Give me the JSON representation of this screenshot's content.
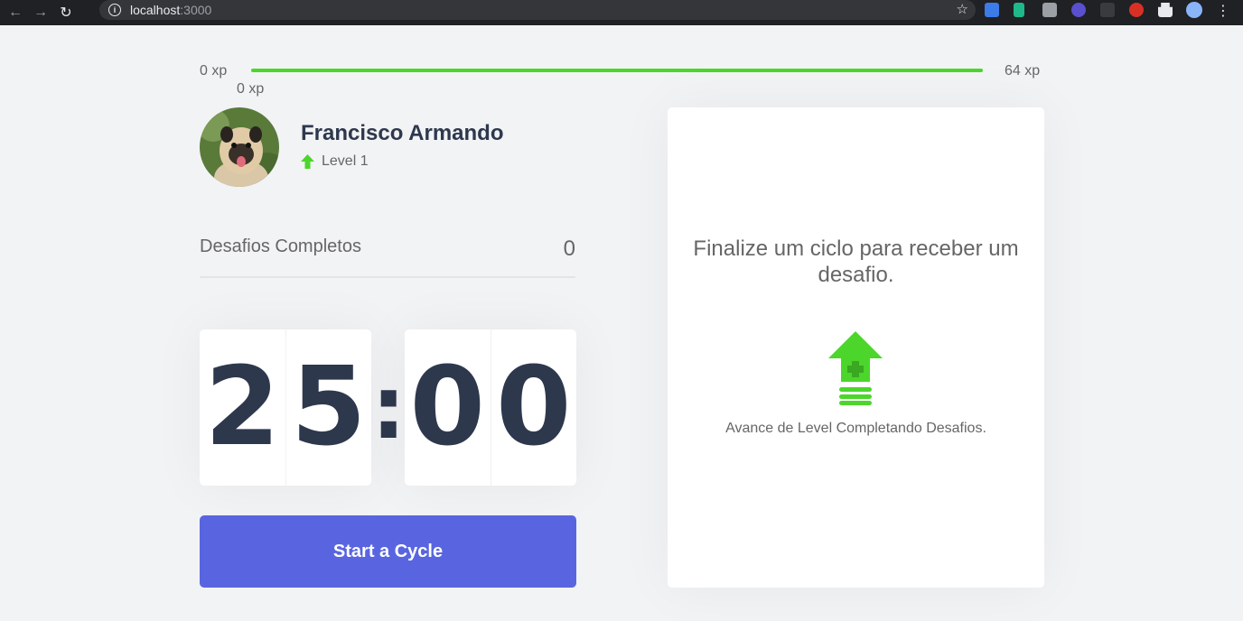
{
  "browser": {
    "url_host": "localhost",
    "url_port": ":3000"
  },
  "experience": {
    "start_label": "0 xp",
    "current_label": "0 xp",
    "end_label": "64 xp",
    "progress_percent": 100,
    "bar_color": "#4cd62b"
  },
  "profile": {
    "name": "Francisco Armando",
    "level_label": "Level 1",
    "level_icon": "level-up-arrow-icon"
  },
  "completed_challenges": {
    "label": "Desafios Completos",
    "value": "0"
  },
  "countdown": {
    "minute_left": "2",
    "minute_right": "5",
    "separator": ":",
    "second_left": "0",
    "second_right": "0"
  },
  "start_button": {
    "label": "Start a Cycle",
    "color": "#5965e0"
  },
  "challenge_box": {
    "title": "Finalize um ciclo para receber um desafio.",
    "subtitle": "Avance de Level Completando Desafios.",
    "icon": "level-up-icon"
  }
}
